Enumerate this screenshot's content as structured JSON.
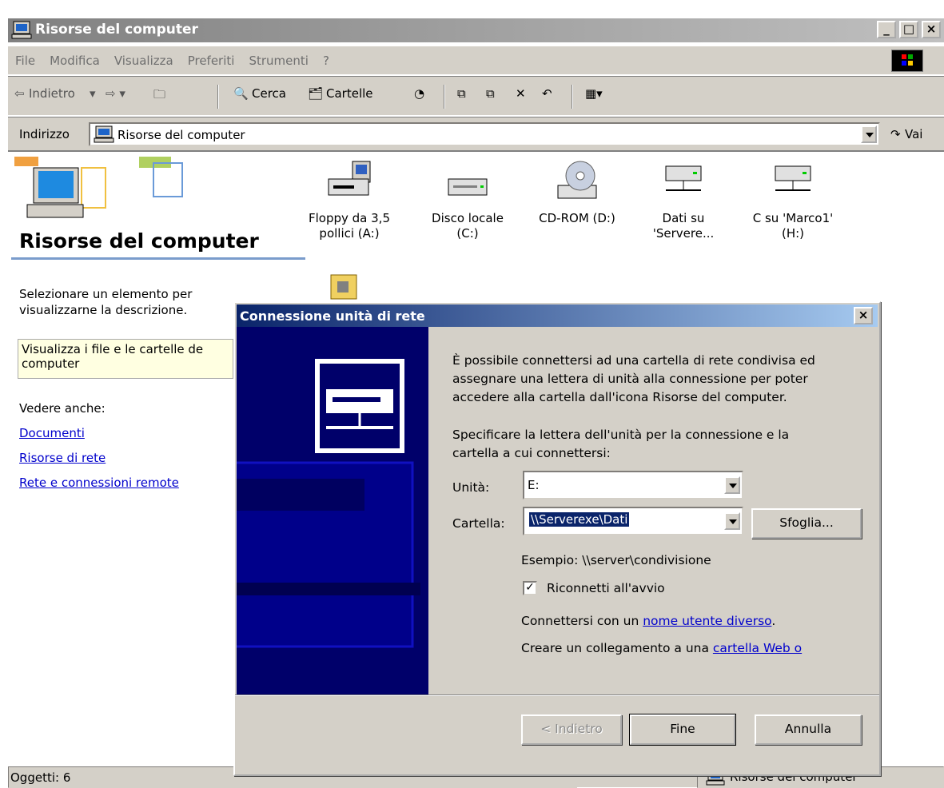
{
  "window": {
    "title": "Risorse del computer"
  },
  "menu": [
    "File",
    "Modifica",
    "Visualizza",
    "Preferiti",
    "Strumenti",
    "?"
  ],
  "toolbar": {
    "back": "Indietro",
    "search": "Cerca",
    "folders": "Cartelle"
  },
  "address": {
    "label": "Indirizzo",
    "value": "Risorse del computer",
    "go": "Vai"
  },
  "left_panel": {
    "title": "Risorse del computer",
    "description": "Selezionare un elemento per visualizzarne la descrizione.",
    "tip_line1": "Visualizza i file e le cartelle de",
    "tip_line2": "computer",
    "see_also": "Vedere anche:",
    "links": [
      "Documenti",
      "Risorse di rete",
      "Rete e connessioni remote"
    ]
  },
  "drives": [
    {
      "line1": "Floppy da 3,5",
      "line2": "pollici (A:)"
    },
    {
      "line1": "Disco locale",
      "line2": "(C:)"
    },
    {
      "line1": "CD-ROM (D:)",
      "line2": ""
    },
    {
      "line1": "Dati su",
      "line2": "'Servere..."
    },
    {
      "line1": "C su 'Marco1'",
      "line2": "(H:)"
    }
  ],
  "dialog": {
    "title": "Connessione unità di rete",
    "intro1": "È possibile connettersi ad una cartella di rete condivisa ed",
    "intro2": "assegnare una lettera di unità alla connessione per poter",
    "intro3": "accedere alla cartella dall'icona Risorse del computer.",
    "spec1": "Specificare la lettera dell'unità per la connessione e la",
    "spec2": "cartella a cui connettersi:",
    "drive_label": "Unità:",
    "drive_value": "E:",
    "folder_label": "Cartella:",
    "folder_value": "\\\\Serverexe\\Dati",
    "browse": "Sfoglia...",
    "example": "Esempio: \\\\server\\condivisione",
    "reconnect": "Riconnetti all'avvio",
    "user_prefix": "Connettersi con un ",
    "user_link": "nome utente diverso",
    "user_suffix": ".",
    "web_prefix": "Creare un collegamento a una ",
    "web_link": "cartella Web o",
    "btn_back": "< Indietro",
    "btn_finish": "Fine",
    "btn_cancel": "Annulla"
  },
  "status": {
    "objects": "Oggetti: 6",
    "zone": "Risorse del computer"
  }
}
